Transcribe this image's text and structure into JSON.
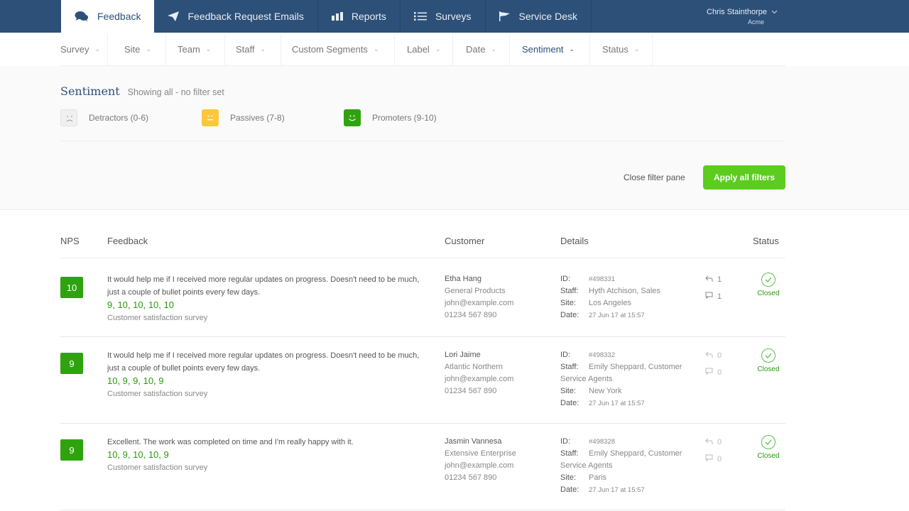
{
  "topnav": {
    "tabs": [
      {
        "label": "Feedback",
        "icon": "chat-bubbles-icon",
        "active": true
      },
      {
        "label": "Feedback Request Emails",
        "icon": "paper-plane-icon",
        "active": false
      },
      {
        "label": "Reports",
        "icon": "bar-chart-icon",
        "active": false
      },
      {
        "label": "Surveys",
        "icon": "list-icon",
        "active": false
      },
      {
        "label": "Service Desk",
        "icon": "flag-icon",
        "active": false
      }
    ],
    "user": {
      "name": "Chris Stainthorpe",
      "org": "Acme"
    }
  },
  "filters": [
    {
      "label": "Survey"
    },
    {
      "label": "Site"
    },
    {
      "label": "Team"
    },
    {
      "label": "Staff"
    },
    {
      "label": "Custom Segments"
    },
    {
      "label": "Label"
    },
    {
      "label": "Date"
    },
    {
      "label": "Sentiment",
      "active": true
    },
    {
      "label": "Status"
    }
  ],
  "sentiment_pane": {
    "title": "Sentiment",
    "subtitle": "Showing all - no filter set",
    "options": [
      {
        "label": "Detractors (0-6)",
        "icon": "sad-face-icon",
        "color": "#f0f0f0"
      },
      {
        "label": "Passives (7-8)",
        "icon": "neutral-face-icon",
        "color": "#fcc83a"
      },
      {
        "label": "Promoters (9-10)",
        "icon": "happy-face-icon",
        "color": "#2fa30f"
      }
    ],
    "close_label": "Close filter pane",
    "apply_label": "Apply all filters"
  },
  "table": {
    "headers": {
      "nps": "NPS",
      "feedback": "Feedback",
      "customer": "Customer",
      "details": "Details",
      "status": "Status"
    },
    "rows": [
      {
        "nps": "10",
        "text": "It would help me if I received more regular updates on progress. Doesn't need to be much, just a couple of bullet points every few days.",
        "scores": "9, 10, 10, 10, 10",
        "survey": "Customer satisfaction survey",
        "customer": {
          "name": "Etha Hang",
          "company": "General Products",
          "email": "john@example.com",
          "phone": "01234 567 890"
        },
        "details": {
          "id_label": "ID:",
          "id": "#498331",
          "staff_label": "Staff:",
          "staff": "Hyth Atchison, Sales",
          "site_label": "Site:",
          "site": "Los Angeles",
          "date_label": "Date:",
          "date": "27 Jun 17 at 15:57"
        },
        "replies": "1",
        "notes": "1",
        "status": "Closed"
      },
      {
        "nps": "9",
        "text": "It would help me if I received more regular updates on progress. Doesn't need to be much, just a couple of bullet points every few days.",
        "scores": "10, 9, 9, 10, 9",
        "survey": "Customer satisfaction survey",
        "customer": {
          "name": "Lori Jaime",
          "company": "Atlantic Northern",
          "email": "john@example.com",
          "phone": "01234 567 890"
        },
        "details": {
          "id_label": "ID:",
          "id": "#498332",
          "staff_label": "Staff:",
          "staff": "Emily Sheppard, Customer Service Agents",
          "site_label": "Site:",
          "site": "New York",
          "date_label": "Date:",
          "date": "27 Jun 17 at 15:57"
        },
        "replies": "0",
        "notes": "0",
        "status": "Closed"
      },
      {
        "nps": "9",
        "text": "Excellent. The work was completed on time and I'm really happy with it.",
        "scores": "10, 9, 10, 10, 9",
        "survey": "Customer satisfaction survey",
        "customer": {
          "name": "Jasmin Vannesa",
          "company": "Extensive Enterprise",
          "email": "john@example.com",
          "phone": "01234 567 890"
        },
        "details": {
          "id_label": "ID:",
          "id": "#498328",
          "staff_label": "Staff:",
          "staff": "Emily Sheppard, Customer Service Agents",
          "site_label": "Site:",
          "site": "Paris",
          "date_label": "Date:",
          "date": "27 Jun 17 at 15:57"
        },
        "replies": "0",
        "notes": "0",
        "status": "Closed"
      }
    ]
  }
}
